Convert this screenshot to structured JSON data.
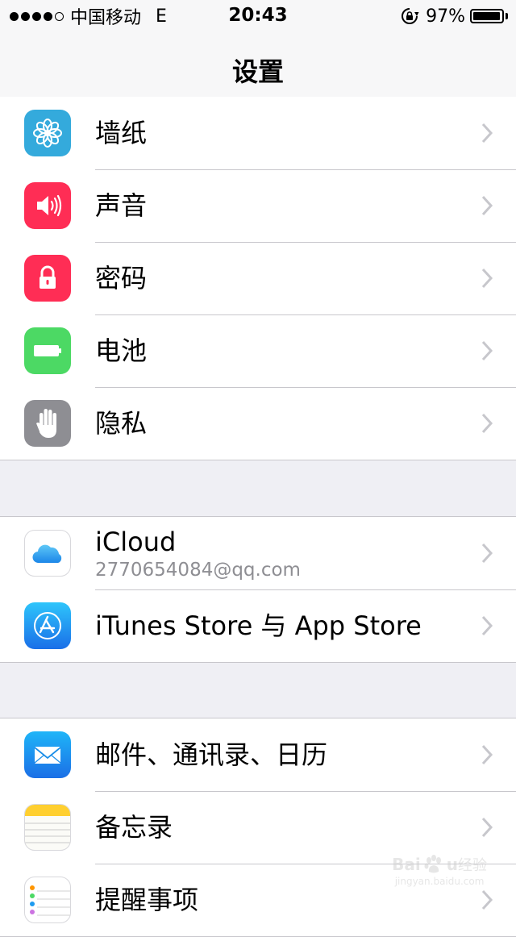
{
  "status_bar": {
    "carrier": "中国移动",
    "network": "E",
    "time": "20:43",
    "battery_percent": "97%",
    "battery_level": 0.97,
    "signal_bars_filled": 4,
    "signal_bars_total": 5,
    "icons": {
      "orientation_lock": "rotation-lock-icon"
    }
  },
  "nav": {
    "title": "设置"
  },
  "groups": [
    {
      "items": [
        {
          "label": "墙纸",
          "icon": "wallpaper-flower-icon",
          "color": "#34aadc"
        },
        {
          "label": "声音",
          "icon": "speaker-icon",
          "color": "#ff2d55"
        },
        {
          "label": "密码",
          "icon": "lock-icon",
          "color": "#ff2d55"
        },
        {
          "label": "电池",
          "icon": "battery-icon",
          "color": "#4cd964"
        },
        {
          "label": "隐私",
          "icon": "hand-icon",
          "color": "#8e8e93"
        }
      ]
    },
    {
      "items": [
        {
          "label": "iCloud",
          "sublabel": "2770654084@qq.com",
          "icon": "icloud-icon",
          "color": "#ffffff"
        },
        {
          "label": "iTunes Store 与 App Store",
          "icon": "app-store-icon",
          "color": "#1a8cf0"
        }
      ]
    },
    {
      "items": [
        {
          "label": "邮件、通讯录、日历",
          "icon": "mail-icon",
          "color": "#1e9bf0"
        },
        {
          "label": "备忘录",
          "icon": "notes-icon",
          "color": "#ffd234"
        },
        {
          "label": "提醒事项",
          "icon": "reminders-icon",
          "color": "#ffffff"
        }
      ]
    }
  ],
  "watermark": {
    "brand_prefix": "Bai",
    "brand_suffix": "u",
    "brand_cn": "经验",
    "url": "jingyan.baidu.com"
  }
}
